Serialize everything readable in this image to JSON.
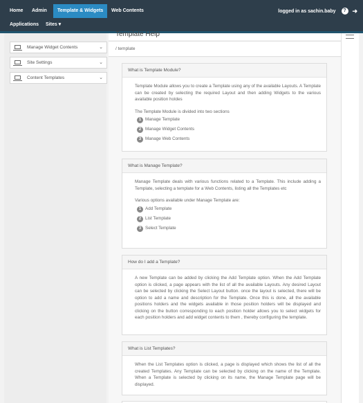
{
  "nav": {
    "home": "Home",
    "admin": "Admin",
    "template_widgets": "Template & Widgets",
    "web_contents": "Web Contents",
    "applications": "Applications",
    "sites": "Sites ▾",
    "logged_in": "logged in as sachin.baby",
    "help_icon": "?",
    "logout_icon": "➜"
  },
  "sidebar": {
    "items": [
      {
        "label": "Manage Widget Contents"
      },
      {
        "label": "Site Settings"
      },
      {
        "label": "Content Templates"
      }
    ]
  },
  "main": {
    "title": "Template Help",
    "breadcrumb": "/ template"
  },
  "panels": [
    {
      "heading": "What is Template Module?",
      "para1": "Template Module allows you to create a Template using any of the available Layouts. A Template can be created by selecting the required Layout and then adding Widgets to the various available position holdes",
      "para2": "The Template Module is divided into two sections",
      "items": [
        "Manage Template",
        "Manage Widget Contents",
        "Manage Web Contents"
      ]
    },
    {
      "heading": "What is Manage Template?",
      "para1": "Manage Template deals with various functions related to a Template. This include adding a Template, selecting a template for a Web Contents, listing all the Templates etc",
      "para2": "Various options available under Manage Template are:",
      "items": [
        "Add Template",
        "List Template",
        "Select Template"
      ]
    },
    {
      "heading": "How do I add a Template?",
      "para1": "A new Template can be added by clicking the Add Template option. When the Add Template option is clicked, a page appears with the list of all the available Layouts. Any desired Layout can be selected by clicking the Select Layout button. once the layout is selected, there will be option to add a name and description for the Template. Once this is done, all the available positions holders and the widgets available in those position holders will be displayed and clicking on the button corresponding to each position holder allows you to select widgets for each position holders and add widget contents to them , thereby configuring the template."
    },
    {
      "heading": "What is List Templates?",
      "para1": "When the List Templates option is clicked, a page is displayed which shows the list of all the created Templates. Any Template can be selected by clicking on the name of the Template. When a Template is selected by clicking on its name, the Manage Template page will be displayed."
    }
  ]
}
